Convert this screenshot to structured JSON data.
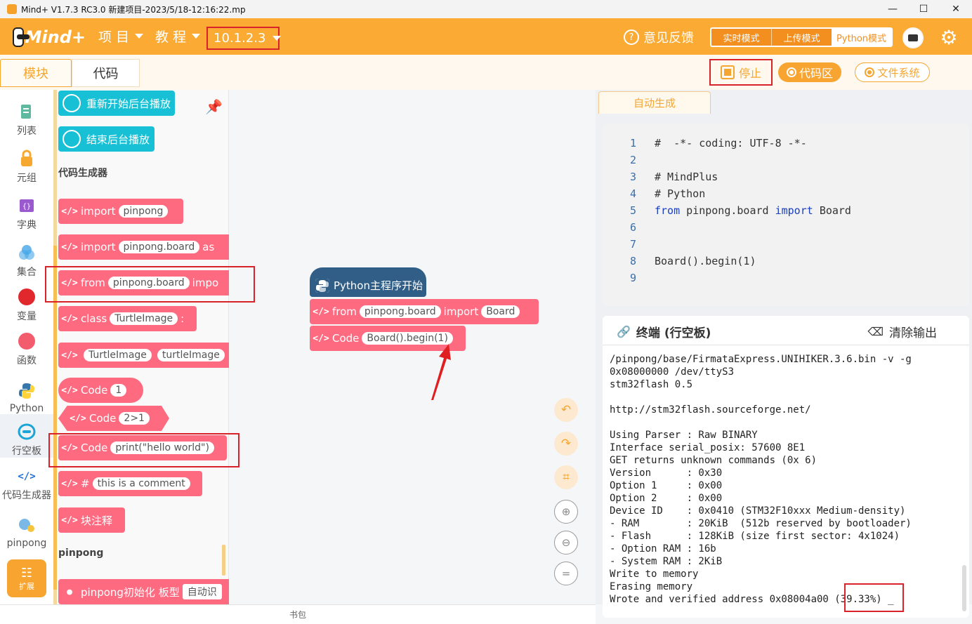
{
  "window": {
    "title": "Mind+ V1.7.3 RC3.0   新建项目-2023/5/18-12:16:22.mp",
    "min": "—",
    "max": "☐",
    "close": "✕"
  },
  "menubar": {
    "logo_text": "Mind+",
    "project": "项 目",
    "tutorial": "教 程",
    "version": "10.1.2.3",
    "feedback": "意见反馈",
    "modes": [
      "实时模式",
      "上传模式",
      "Python模式"
    ],
    "active_mode": "Python模式"
  },
  "tabs": {
    "blocks": "模块",
    "code": "代码"
  },
  "actions": {
    "stop": "停止",
    "code_area": "代码区",
    "file_system": "文件系统"
  },
  "categories": [
    {
      "label": "列表",
      "icon": "list-icon",
      "color": "#5fb9a0"
    },
    {
      "label": "元组",
      "icon": "tuple-lock-icon",
      "color": "#f6a82f"
    },
    {
      "label": "字典",
      "icon": "dict-icon",
      "color": "#9b59d0"
    },
    {
      "label": "集合",
      "icon": "set-icon",
      "color": "#47a6e8"
    },
    {
      "label": "变量",
      "icon": "variable-icon",
      "color": "#e0282d"
    },
    {
      "label": "函数",
      "icon": "function-icon",
      "color": "#f35c6c"
    },
    {
      "label": "Python",
      "icon": "python-icon",
      "color": "#3776ab"
    },
    {
      "label": "行空板",
      "icon": "unihiker-icon",
      "color": "#1aa5d6"
    },
    {
      "label": "代码生成器",
      "icon": "code-generator-icon",
      "color": "#1f6fd6"
    },
    {
      "label": "pinpong",
      "icon": "pinpong-icon",
      "color": "#7ab8e8"
    }
  ],
  "extension": "扩展",
  "palette": {
    "audio_restart": "重新开始后台播放",
    "audio_stop": "结束后台播放",
    "section_codegen": "代码生成器",
    "blocks": [
      {
        "kw": "import",
        "field": "pinpong",
        "tail": ""
      },
      {
        "kw": "import",
        "field": "pinpong.board",
        "tail": "as"
      },
      {
        "kw": "from",
        "field": "pinpong.board",
        "tail": "impo"
      },
      {
        "kw": "class",
        "field": "TurtleImage",
        "tail": ":"
      },
      {
        "kw": "",
        "field": "TurtleImage",
        "field2": "turtleImage"
      },
      {
        "kw": "Code",
        "field": "1"
      },
      {
        "kw": "Code",
        "field": "2>1"
      },
      {
        "kw": "Code",
        "field": "print(\"hello world\")"
      },
      {
        "kw": "#",
        "field": "this is a comment"
      },
      {
        "kw": "块注释"
      }
    ],
    "section_pinpong": "pinpong",
    "pinpong_init": "pinpong初始化 板型",
    "pinpong_init_field": "自动识"
  },
  "workspace": {
    "hat": "Python主程序开始",
    "block_from": {
      "kw": "from",
      "field1": "pinpong.board",
      "mid": "import",
      "field2": "Board"
    },
    "block_code": {
      "kw": "Code",
      "field": "Board().begin(1)"
    }
  },
  "code_panel": {
    "tab": "自动生成",
    "lines": [
      {
        "n": "1",
        "t": "#  -*- coding: UTF-8 -*-"
      },
      {
        "n": "2",
        "t": ""
      },
      {
        "n": "3",
        "t": "# MindPlus"
      },
      {
        "n": "4",
        "t": "# Python"
      },
      {
        "n": "5",
        "t": "from pinpong.board import Board"
      },
      {
        "n": "6",
        "t": ""
      },
      {
        "n": "7",
        "t": ""
      },
      {
        "n": "8",
        "t": "Board().begin(1)"
      },
      {
        "n": "9",
        "t": ""
      }
    ]
  },
  "terminal": {
    "title": "终端 (行空板)",
    "clear": "清除输出",
    "output": "/pinpong/base/FirmataExpress.UNIHIKER.3.6.bin -v -g\n0x08000000 /dev/ttyS3\nstm32flash 0.5\n\nhttp://stm32flash.sourceforge.net/\n\nUsing Parser : Raw BINARY\nInterface serial_posix: 57600 8E1\nGET returns unknown commands (0x 6)\nVersion      : 0x30\nOption 1     : 0x00\nOption 2     : 0x00\nDevice ID    : 0x0410 (STM32F10xxx Medium-density)\n- RAM        : 20KiB  (512b reserved by bootloader)\n- Flash      : 128KiB (size first sector: 4x1024)\n- Option RAM : 16b\n- System RAM : 2KiB\nWrite to memory\nErasing memory\nWrote and verified address 0x08004a00 (39.33%) _"
  },
  "bottom": "书包",
  "colors": {
    "brand": "#fbab33",
    "block_pink": "#fe6a80",
    "block_cyan": "#17c0d4",
    "python_hat": "#305e86",
    "highlight": "#d8232a"
  }
}
